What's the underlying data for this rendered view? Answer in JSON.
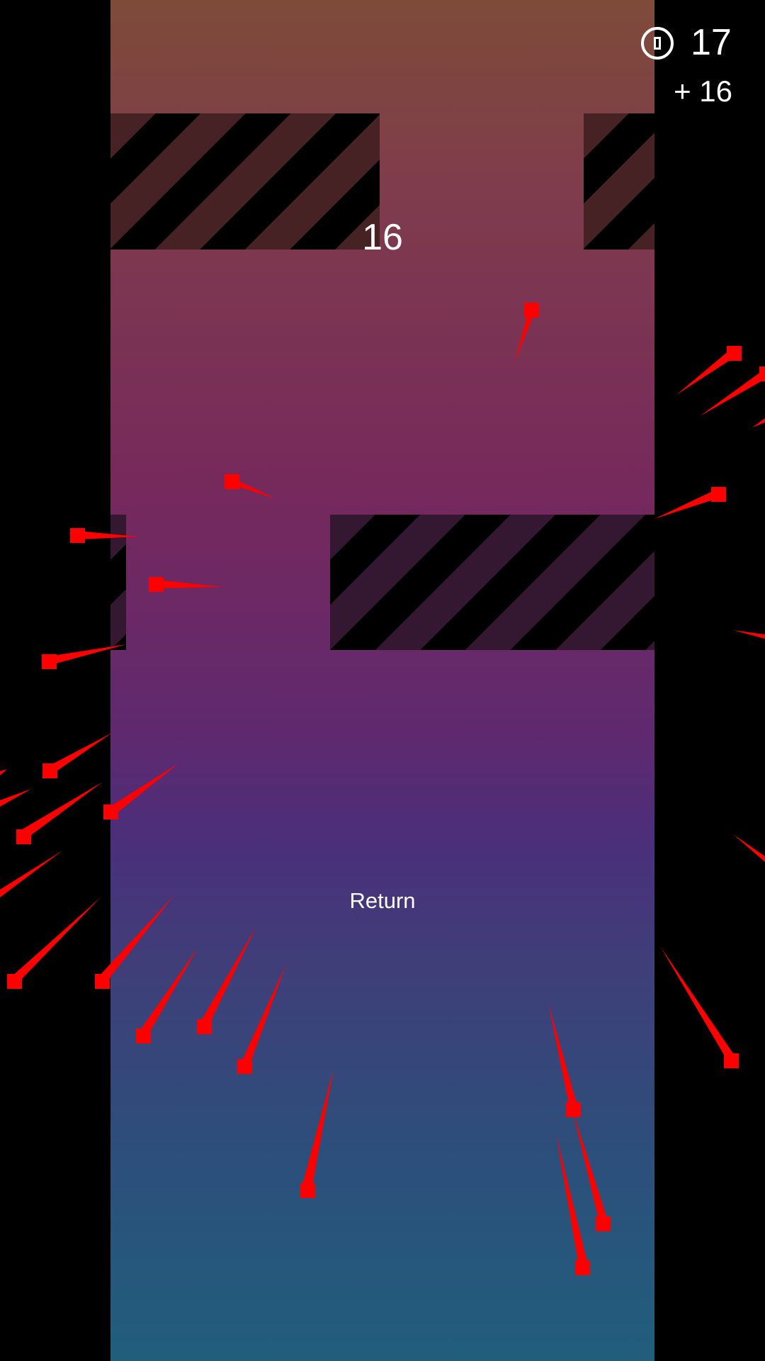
{
  "hud": {
    "coin_icon": "coin-icon",
    "coin_count": "17",
    "coin_gain": "+ 16"
  },
  "score": "16",
  "return_label": "Return",
  "colors": {
    "particle": "#ff0000",
    "text": "#ffffff",
    "background_top": "#7e4b39",
    "background_bottom": "#215e7c"
  }
}
